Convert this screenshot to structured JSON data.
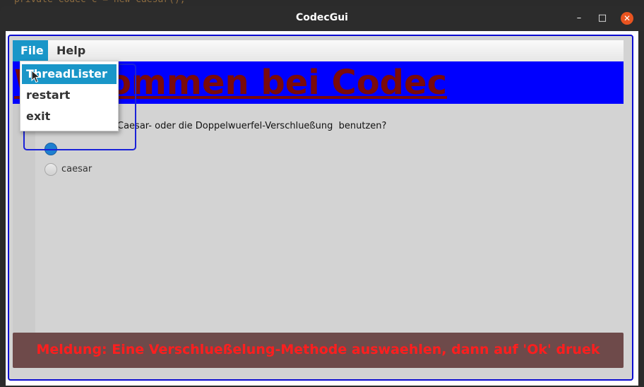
{
  "background_code": "private Codec c = new Caesar();",
  "window": {
    "title": "CodecGui",
    "minimize_glyph": "–",
    "maximize_glyph": "□",
    "close_glyph": "✕"
  },
  "menubar": {
    "file_label": "File",
    "help_label": "Help"
  },
  "file_menu": {
    "items": [
      {
        "label": "ThreadLister",
        "selected": true
      },
      {
        "label": "restart"
      },
      {
        "label": "exit"
      }
    ]
  },
  "banner": {
    "text": "Willkommen bei Codec"
  },
  "question": {
    "text": "Caesar- oder die Doppelwuerfel-Verschlueßung  benutzen?"
  },
  "radios": {
    "caesar_label": "caesar"
  },
  "status": {
    "text": "Meldung: Eine Verschlueßelung-Methode auswaehlen, dann auf 'Ok' druek"
  },
  "colors": {
    "accent": "#1996c8",
    "banner_bg": "#0000ff",
    "banner_text": "#7a0a0a",
    "status_bg": "#6e4a4a",
    "status_text": "#ff1e1e",
    "frame_border": "#0b0bd0",
    "close_button": "#e95420"
  }
}
